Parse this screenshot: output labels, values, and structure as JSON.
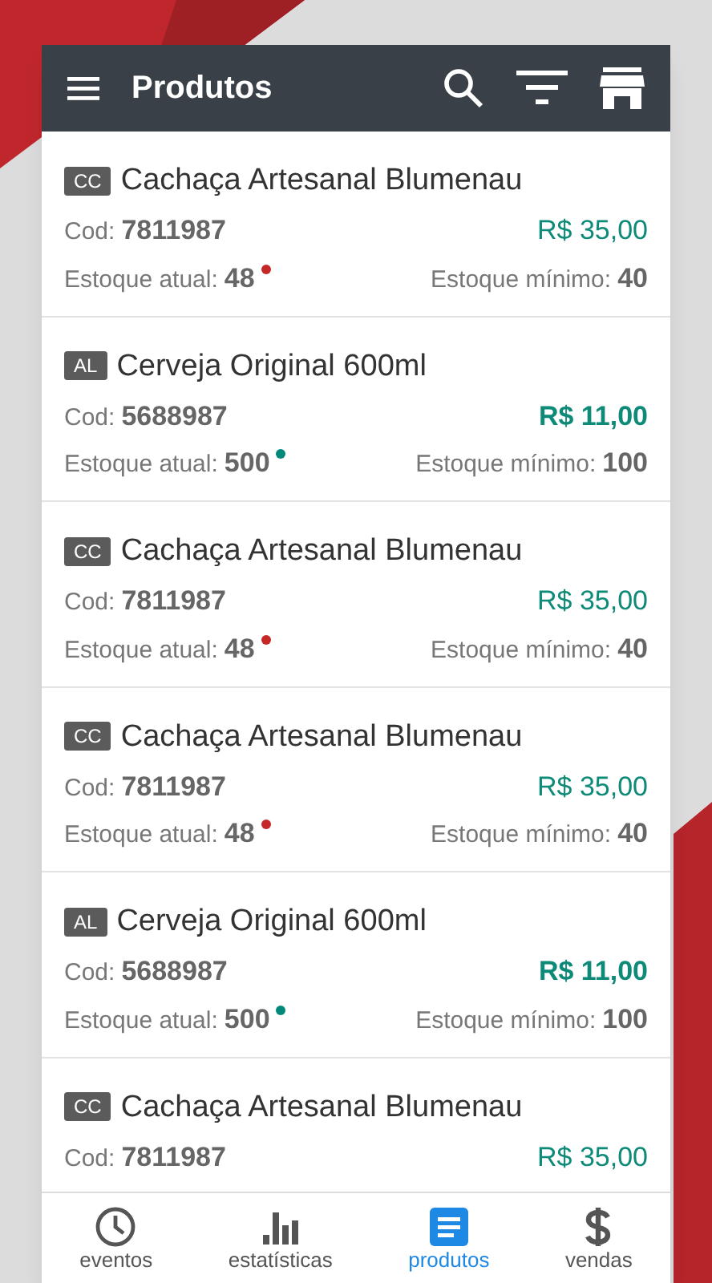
{
  "header": {
    "title": "Produtos"
  },
  "products": [
    {
      "tag": "CC",
      "name": "Cachaça Artesanal Blumenau",
      "code_label": "Cod:",
      "code": "7811987",
      "price": "R$ 35,00",
      "price_emphasized": false,
      "stock_label": "Estoque atual:",
      "stock": "48",
      "color": "#c62828",
      "min_label": "Estoque mínimo:",
      "min": "40"
    },
    {
      "tag": "AL",
      "name": "Cerveja Original 600ml",
      "code_label": "Cod:",
      "code": "5688987",
      "price": "R$ 11,00",
      "price_emphasized": true,
      "stock_label": "Estoque atual:",
      "stock": "500",
      "color": "#00897b",
      "min_label": "Estoque mínimo:",
      "min": "100"
    },
    {
      "tag": "CC",
      "name": "Cachaça Artesanal Blumenau",
      "code_label": "Cod:",
      "code": "7811987",
      "price": "R$ 35,00",
      "price_emphasized": false,
      "stock_label": "Estoque atual:",
      "stock": "48",
      "color": "#c62828",
      "min_label": "Estoque mínimo:",
      "min": "40"
    },
    {
      "tag": "CC",
      "name": "Cachaça Artesanal Blumenau",
      "code_label": "Cod:",
      "code": "7811987",
      "price": "R$ 35,00",
      "price_emphasized": false,
      "stock_label": "Estoque atual:",
      "stock": "48",
      "color": "#c62828",
      "min_label": "Estoque mínimo:",
      "min": "40"
    },
    {
      "tag": "AL",
      "name": "Cerveja Original 600ml",
      "code_label": "Cod:",
      "code": "5688987",
      "price": "R$ 11,00",
      "price_emphasized": true,
      "stock_label": "Estoque atual:",
      "stock": "500",
      "color": "#00897b",
      "min_label": "Estoque mínimo:",
      "min": "100"
    },
    {
      "tag": "CC",
      "name": "Cachaça Artesanal Blumenau",
      "code_label": "Cod:",
      "code": "7811987",
      "price": "R$ 35,00",
      "price_emphasized": false
    }
  ],
  "bottom_nav": [
    {
      "kind": "clock",
      "label": "eventos",
      "selected": false
    },
    {
      "kind": "chart",
      "label": "estatísticas",
      "selected": false
    },
    {
      "kind": "list",
      "label": "produtos",
      "selected": true
    },
    {
      "kind": "dollar",
      "label": "vendas",
      "selected": false
    }
  ]
}
